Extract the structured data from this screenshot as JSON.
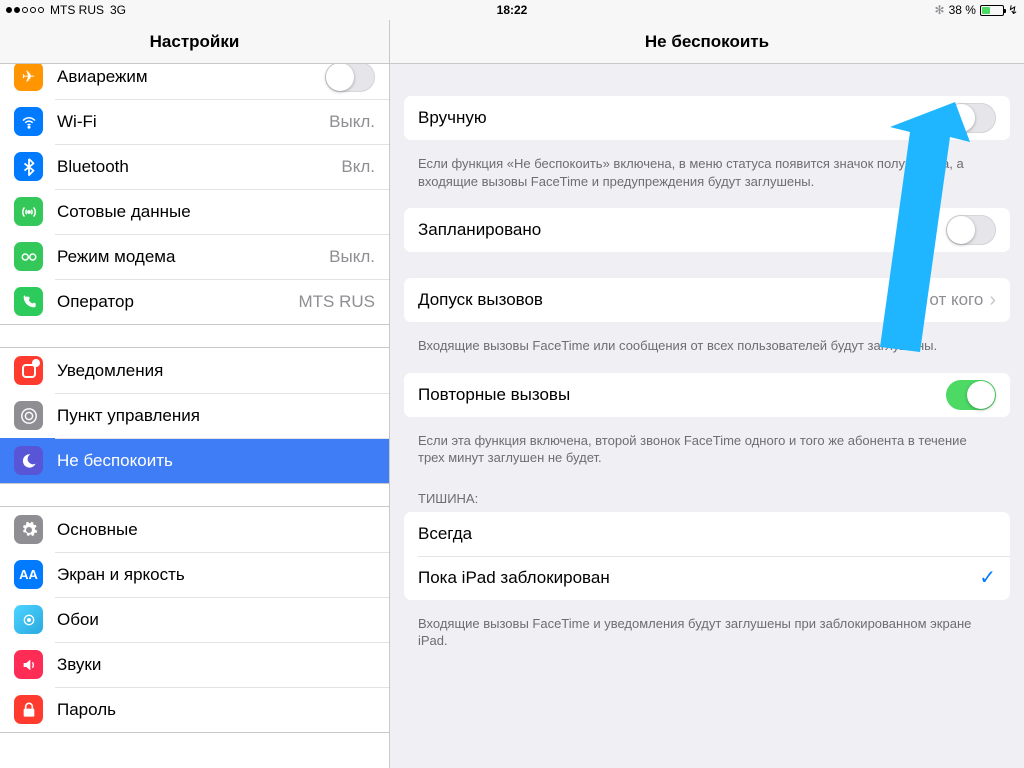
{
  "status": {
    "carrier": "MTS RUS",
    "network": "3G",
    "time": "18:22",
    "battery_percent": "38 %",
    "bluetooth_glyph": "✻",
    "bolt_glyph": "↯"
  },
  "header": {
    "left_title": "Настройки",
    "right_title": "Не беспокоить"
  },
  "sidebar": {
    "g1": {
      "airplane": {
        "label": "Авиарежим"
      },
      "wifi": {
        "label": "Wi-Fi",
        "detail": "Выкл."
      },
      "bluetooth": {
        "label": "Bluetooth",
        "detail": "Вкл."
      },
      "cellular": {
        "label": "Сотовые данные"
      },
      "hotspot": {
        "label": "Режим модема",
        "detail": "Выкл."
      },
      "carrier": {
        "label": "Оператор",
        "detail": "MTS RUS"
      }
    },
    "g2": {
      "notifications": {
        "label": "Уведомления"
      },
      "control": {
        "label": "Пункт управления"
      },
      "dnd": {
        "label": "Не беспокоить"
      }
    },
    "g3": {
      "general": {
        "label": "Основные"
      },
      "display": {
        "label": "Экран и яркость"
      },
      "wallpaper": {
        "label": "Обои"
      },
      "sounds": {
        "label": "Звуки"
      },
      "passcode": {
        "label": "Пароль"
      }
    }
  },
  "content": {
    "manual": {
      "label": "Вручную"
    },
    "manual_note": "Если функция «Не беспокоить» включена, в меню статуса появится значок полумесяца, а входящие вызовы FaceTime и предупреждения будут заглуше­ны.",
    "scheduled": {
      "label": "Запланировано"
    },
    "allow_calls": {
      "label": "Допуск вызовов",
      "value": "Ни от кого"
    },
    "allow_note": "Входящие вызовы FaceTime или сообщения от всех пользователей будут заглушены.",
    "repeated": {
      "label": "Повторные вызовы"
    },
    "repeated_note": "Если эта функция включена, второй звонок FaceTime одного и того же абонента в течение трех минут заглушен не будет.",
    "silence_header": "Тишина:",
    "silence1": {
      "label": "Всегда"
    },
    "silence2": {
      "label": "Пока iPad заблокирован"
    },
    "silence_note": "Входящие вызовы FaceTime и уведомления будут заглушены при заблокированном экране iPad."
  }
}
